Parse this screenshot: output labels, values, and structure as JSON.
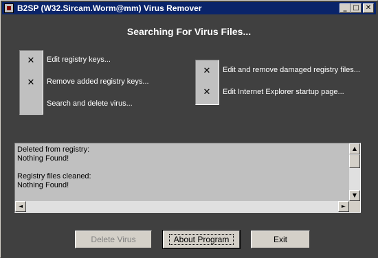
{
  "window": {
    "title": "B2SP (W32.Sircam.Worm@mm) Virus Remover",
    "minimize": "_",
    "maximize": "□",
    "close": "✕",
    "colors": {
      "titlebar": "#0a246a",
      "background": "#404040",
      "panel": "#c0c0c0"
    }
  },
  "heading": "Searching For Virus Files...",
  "tasks_left": [
    {
      "label": "Edit registry keys...",
      "done": true,
      "mark": "✕"
    },
    {
      "label": "Remove added registry keys...",
      "done": true,
      "mark": "✕"
    },
    {
      "label": "Search and delete virus...",
      "done": false,
      "mark": ""
    }
  ],
  "tasks_right": [
    {
      "label": "Edit and remove damaged registry files...",
      "done": true,
      "mark": "✕"
    },
    {
      "label": "Edit Internet Explorer startup page...",
      "done": true,
      "mark": "✕"
    }
  ],
  "log": {
    "text": "Deleted from registry:\nNothing Found!\n\nRegistry files cleaned:\nNothing Found!"
  },
  "scroll": {
    "up": "▲",
    "down": "▼",
    "left": "◄",
    "right": "►"
  },
  "buttons": {
    "delete_virus": "Delete Virus",
    "about_program": "About Program",
    "exit": "Exit"
  }
}
